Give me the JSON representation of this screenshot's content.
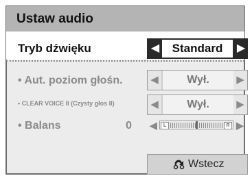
{
  "title": "Ustaw audio",
  "sound_mode": {
    "label": "Tryb dźwięku",
    "value": "Standard",
    "left": "◀",
    "right": "▶"
  },
  "auto_volume": {
    "label": "• Aut. poziom głośn.",
    "value": "Wył.",
    "left": "◀",
    "right": "▶"
  },
  "clear_voice": {
    "label": "• CLEAR VOICE II (Czysty głos II)",
    "value": "Wył.",
    "left": "◀",
    "right": "▶"
  },
  "balance": {
    "label": "• Balans",
    "value": "0",
    "left_marker": "L",
    "right_marker": "R",
    "left": "◀",
    "right": "▶"
  },
  "back_button": {
    "label": "Wstecz",
    "icon": "back-return-icon"
  }
}
